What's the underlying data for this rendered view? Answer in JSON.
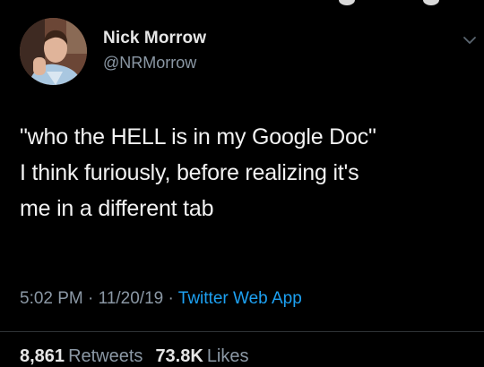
{
  "user": {
    "name": "Nick Morrow",
    "handle": "@NRMorrow",
    "avatar_icon": "profile-photo"
  },
  "tweet": {
    "text": "\"who the HELL is in my Google Doc\"\nI think furiously, before realizing it's\nme in a different tab"
  },
  "meta": {
    "time": "5:02 PM",
    "separator": " · ",
    "date": "11/20/19",
    "source": "Twitter Web App"
  },
  "stats": {
    "retweets_count": "8,861",
    "retweets_label": "Retweets",
    "likes_count": "73.8K",
    "likes_label": "Likes"
  },
  "colors": {
    "background": "#000000",
    "text": "#f2f2f2",
    "secondary": "#8b98a5",
    "link": "#1da1f2"
  }
}
